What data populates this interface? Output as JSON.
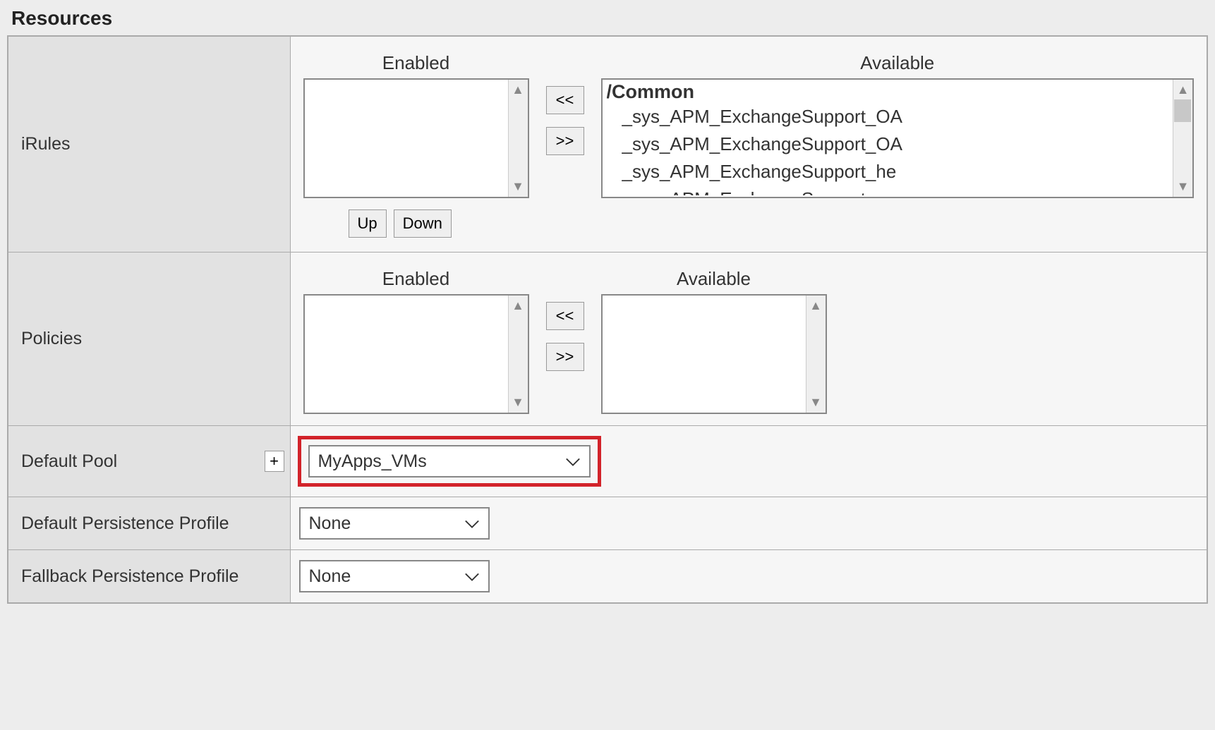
{
  "section_title": "Resources",
  "rows": {
    "irules": {
      "label": "iRules",
      "enabled_header": "Enabled",
      "available_header": "Available",
      "available_group": "/Common",
      "available_items": [
        "_sys_APM_ExchangeSupport_OA",
        "_sys_APM_ExchangeSupport_OA",
        "_sys_APM_ExchangeSupport_he",
        "_sys_APM_ExchangeSupport_ma"
      ],
      "btn_add": "<<",
      "btn_remove": ">>",
      "btn_up": "Up",
      "btn_down": "Down"
    },
    "policies": {
      "label": "Policies",
      "enabled_header": "Enabled",
      "available_header": "Available",
      "btn_add": "<<",
      "btn_remove": ">>"
    },
    "default_pool": {
      "label": "Default Pool",
      "plus": "+",
      "value": "MyApps_VMs"
    },
    "default_persistence": {
      "label": "Default Persistence Profile",
      "value": "None"
    },
    "fallback_persistence": {
      "label": "Fallback Persistence Profile",
      "value": "None"
    }
  }
}
